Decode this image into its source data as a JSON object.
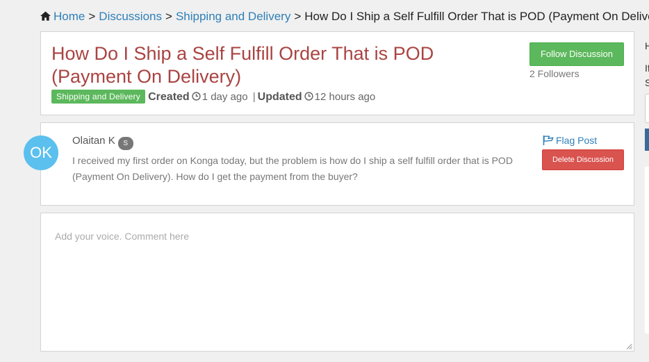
{
  "breadcrumb": {
    "home": "Home",
    "discussions": "Discussions",
    "category": "Shipping and Delivery",
    "current": "How Do I Ship a Self Fulfill Order That is POD (Payment On Delivery)",
    "separator": ">"
  },
  "discussion": {
    "title": "How Do I Ship a Self Fulfill Order That is POD (Payment On Delivery)",
    "tag": "Shipping and Delivery",
    "created_label": "Created",
    "created_value": "1 day ago",
    "meta_divider": "|",
    "updated_label": "Updated",
    "updated_value": "12 hours ago",
    "follow_label": "Follow Discussion",
    "followers": "2 Followers"
  },
  "post": {
    "avatar_initials": "OK",
    "author": "Olaitan K",
    "author_badge": "S",
    "body": "I received my first order on Konga today, but the problem is how do I ship a self fulfill order that is POD (Payment On Delivery). How do I get the payment from the buyer?",
    "flag_label": "Flag Post",
    "delete_label": "Delete Discussion"
  },
  "comment": {
    "placeholder": "Add your voice. Comment here"
  },
  "right_column": {
    "char_1": "H",
    "char_2": "If",
    "char_3": "S"
  },
  "colors": {
    "link": "#2f7fb8",
    "title": "#a94442",
    "success": "#5cb85c",
    "danger": "#d9534f",
    "avatar": "#5bc0ee"
  }
}
